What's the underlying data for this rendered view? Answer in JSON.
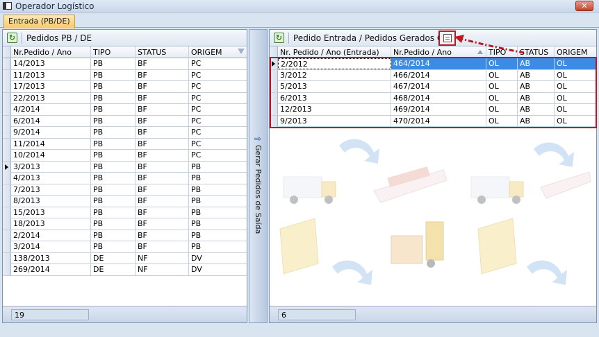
{
  "window": {
    "title": "Operador Logístico",
    "close_glyph": "✕"
  },
  "tabs": [
    {
      "label": "Entrada (PB/DE)"
    }
  ],
  "left_panel": {
    "title": "Pedidos PB / DE",
    "columns": [
      "Nr.Pedido / Ano",
      "TIPO",
      "STATUS",
      "ORIGEM"
    ],
    "rows": [
      [
        "14/2013",
        "PB",
        "BF",
        "PC"
      ],
      [
        "11/2013",
        "PB",
        "BF",
        "PC"
      ],
      [
        "17/2013",
        "PB",
        "BF",
        "PC"
      ],
      [
        "22/2013",
        "PB",
        "BF",
        "PC"
      ],
      [
        "4/2014",
        "PB",
        "BF",
        "PC"
      ],
      [
        "6/2014",
        "PB",
        "BF",
        "PC"
      ],
      [
        "9/2014",
        "PB",
        "BF",
        "PC"
      ],
      [
        "11/2014",
        "PB",
        "BF",
        "PC"
      ],
      [
        "10/2014",
        "PB",
        "BF",
        "PC"
      ],
      [
        "3/2013",
        "PB",
        "BF",
        "PB"
      ],
      [
        "4/2013",
        "PB",
        "BF",
        "PB"
      ],
      [
        "7/2013",
        "PB",
        "BF",
        "PB"
      ],
      [
        "8/2013",
        "PB",
        "BF",
        "PB"
      ],
      [
        "15/2013",
        "PB",
        "BF",
        "PB"
      ],
      [
        "18/2013",
        "PB",
        "BF",
        "PB"
      ],
      [
        "2/2014",
        "PB",
        "BF",
        "PB"
      ],
      [
        "3/2014",
        "PB",
        "BF",
        "PB"
      ],
      [
        "138/2013",
        "DE",
        "NF",
        "DV"
      ],
      [
        "269/2014",
        "DE",
        "NF",
        "DV"
      ]
    ],
    "current_row_index": 9,
    "count": "19"
  },
  "generate_button": {
    "label": "Gerar Pedidos de Saída",
    "arrow": "⇨"
  },
  "right_panel": {
    "title": "Pedido Entrada / Pedidos Gerados O.L.",
    "columns": [
      "Nr. Pedido / Ano (Entrada)",
      "Nr.Pedido / Ano",
      "TIPO",
      "STATUS",
      "ORIGEM"
    ],
    "rows": [
      [
        "2/2012",
        "464/2014",
        "OL",
        "AB",
        "OL"
      ],
      [
        "3/2012",
        "466/2014",
        "OL",
        "AB",
        "OL"
      ],
      [
        "5/2013",
        "467/2014",
        "OL",
        "AB",
        "OL"
      ],
      [
        "6/2013",
        "468/2014",
        "OL",
        "AB",
        "OL"
      ],
      [
        "12/2013",
        "469/2014",
        "OL",
        "AB",
        "OL"
      ],
      [
        "9/2013",
        "470/2014",
        "OL",
        "AB",
        "OL"
      ]
    ],
    "selected_row_index": 0,
    "count": "6"
  },
  "colors": {
    "selection": "#3c8ce6",
    "annotation": "#c0161e",
    "tab_active": "#f7c96b"
  }
}
